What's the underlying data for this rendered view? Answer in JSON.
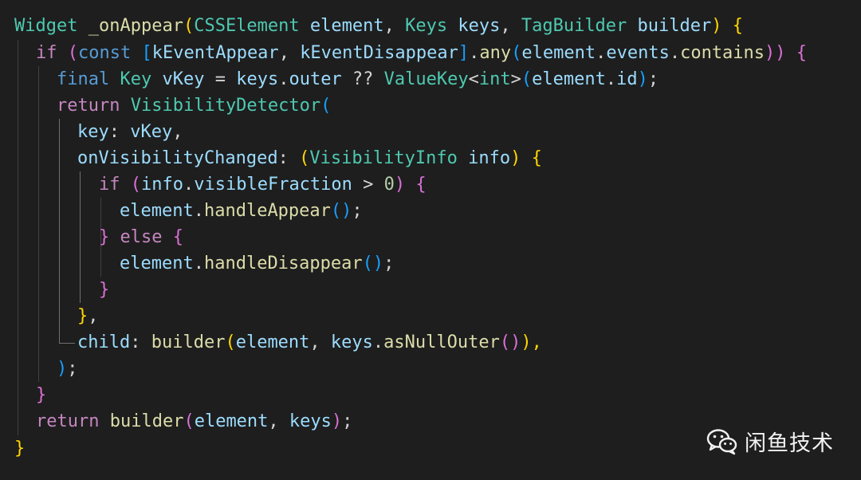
{
  "editor": {
    "theme_colors": {
      "background": "#1e1e1e",
      "type": "#4ec9b0",
      "function": "#dcdcaa",
      "variable": "#9cdcfe",
      "keyword": "#569cd6",
      "control": "#c586c0",
      "number": "#b5cea8",
      "bracket_level_1": "#ffd700",
      "bracket_level_2": "#da70d6",
      "bracket_level_3": "#179fff"
    },
    "code": {
      "l1": [
        "Widget",
        " ",
        "_onAppear",
        "(",
        "CSSElement",
        " ",
        "element",
        ", ",
        "Keys",
        " ",
        "keys",
        ", ",
        "TagBuilder",
        " ",
        "builder",
        ") ",
        "{"
      ],
      "l2": [
        "if",
        " ",
        "(",
        "const",
        " ",
        "[",
        "kEventAppear",
        ", ",
        "kEventDisappear",
        "]",
        ".",
        "any",
        "(",
        "element",
        ".",
        "events",
        ".",
        "contains",
        "))",
        " ",
        "{"
      ],
      "l3": [
        "final",
        " ",
        "Key",
        " ",
        "vKey",
        " = ",
        "keys",
        ".",
        "outer",
        " ?? ",
        "ValueKey",
        "<",
        "int",
        ">",
        "(",
        "element",
        ".",
        "id",
        ")",
        ";"
      ],
      "l4": [
        "return",
        " ",
        "VisibilityDetector",
        "("
      ],
      "l5": [
        "key",
        ": ",
        "vKey",
        ","
      ],
      "l6": [
        "onVisibilityChanged",
        ": ",
        "(",
        "VisibilityInfo",
        " ",
        "info",
        ") ",
        "{"
      ],
      "l7": [
        "if",
        " ",
        "(",
        "info",
        ".",
        "visibleFraction",
        " > ",
        "0",
        ") ",
        "{"
      ],
      "l8": [
        "element",
        ".",
        "handleAppear",
        "()",
        ";"
      ],
      "l9": [
        "}",
        " ",
        "else",
        " ",
        "{"
      ],
      "l10": [
        "element",
        ".",
        "handleDisappear",
        "()",
        ";"
      ],
      "l11": [
        "}"
      ],
      "l12": [
        "}",
        ","
      ],
      "l13": [
        "child",
        ": ",
        "builder",
        "(",
        "element",
        ", ",
        "keys",
        ".",
        "asNullOuter",
        "()",
        "),"
      ],
      "l14": [
        ")",
        ";"
      ],
      "l15": [
        "}"
      ],
      "l16": [
        "return",
        " ",
        "builder",
        "(",
        "element",
        ", ",
        "keys",
        ")",
        ";"
      ],
      "l17": [
        "}"
      ]
    }
  },
  "watermark": {
    "text": "闲鱼技术",
    "icon": "wechat-icon"
  }
}
